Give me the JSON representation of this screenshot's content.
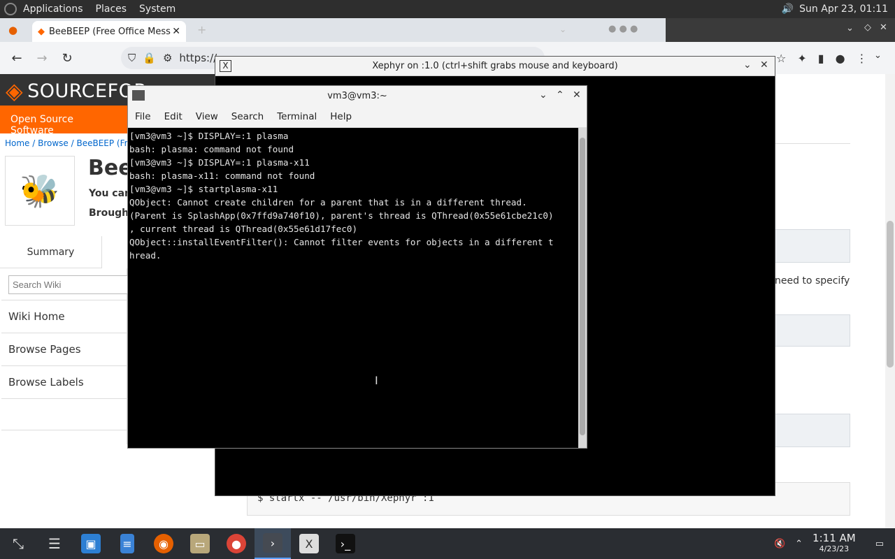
{
  "top_panel": {
    "menus": [
      "Applications",
      "Places",
      "System"
    ],
    "datetime": "Sun Apr 23, 01:11"
  },
  "browser": {
    "tab_title": "BeeBEEP (Free Office Mess",
    "url": "https://",
    "sourceforge": {
      "logo_text": "SOURCEFOR",
      "nav_label": "Open Source Software",
      "breadcrumb": "Home / Browse / BeeBEEP (Free",
      "project_title": "Bee",
      "subtitle_1": "You can",
      "subtitle_2": "Brough",
      "tab_summary": "Summary",
      "search_placeholder": "Search Wiki",
      "sidebar_links": [
        "Wiki Home",
        "Browse Pages",
        "Browse Labels"
      ],
      "right_text": "need to specify",
      "code_snippet": "$ startx -- /usr/bin/Xephyr :1"
    }
  },
  "xephyr": {
    "title": "Xephyr on :1.0 (ctrl+shift grabs mouse and keyboard)"
  },
  "terminal": {
    "title": "vm3@vm3:~",
    "menu": [
      "File",
      "Edit",
      "View",
      "Search",
      "Terminal",
      "Help"
    ],
    "lines": [
      "[vm3@vm3 ~]$ DISPLAY=:1 plasma",
      "bash: plasma: command not found",
      "[vm3@vm3 ~]$ DISPLAY=:1 plasma-x11",
      "bash: plasma-x11: command not found",
      "[vm3@vm3 ~]$ startplasma-x11",
      "QObject: Cannot create children for a parent that is in a different thread.",
      "(Parent is SplashApp(0x7ffd9a740f10), parent's thread is QThread(0x55e61cbe21c0)",
      ", current thread is QThread(0x55e61d17fec0)",
      "QObject::installEventFilter(): Cannot filter events for objects in a different t",
      "hread."
    ]
  },
  "taskbar": {
    "time": "1:11 AM",
    "date": "4/23/23"
  }
}
